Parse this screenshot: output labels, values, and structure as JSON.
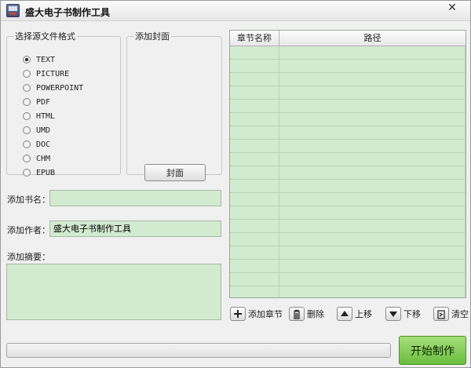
{
  "window": {
    "title": "盛大电子书制作工具",
    "close_glyph": "✕"
  },
  "format_group": {
    "legend": "选择源文件格式",
    "options": [
      {
        "label": "TEXT",
        "checked": true
      },
      {
        "label": "PICTURE",
        "checked": false
      },
      {
        "label": "POWERPOINT",
        "checked": false
      },
      {
        "label": "PDF",
        "checked": false
      },
      {
        "label": "HTML",
        "checked": false
      },
      {
        "label": "UMD",
        "checked": false
      },
      {
        "label": "DOC",
        "checked": false
      },
      {
        "label": "CHM",
        "checked": false
      },
      {
        "label": "EPUB",
        "checked": false
      }
    ]
  },
  "cover_group": {
    "legend": "添加封面",
    "button_label": "封面"
  },
  "fields": {
    "book_name_label": "添加书名：",
    "book_name_value": "",
    "author_label": "添加作者：",
    "author_value": "盛大电子书制作工具",
    "summary_label": "添加摘要：",
    "summary_value": ""
  },
  "chapter_table": {
    "columns": [
      "章节名称",
      "路径"
    ],
    "rows": []
  },
  "toolbar": {
    "add_chapter": "添加章节",
    "delete": "删除",
    "move_up": "上移",
    "move_down": "下移",
    "clear": "清空"
  },
  "progress": {
    "value": 0
  },
  "start_button": "开始制作",
  "icons": {
    "add": "plus-icon",
    "delete": "trash-icon",
    "up": "arrow-up-icon",
    "down": "arrow-down-icon",
    "clear": "clear-icon"
  },
  "colors": {
    "field_bg": "#d2ead0",
    "start_button": "#7fcb4f"
  }
}
